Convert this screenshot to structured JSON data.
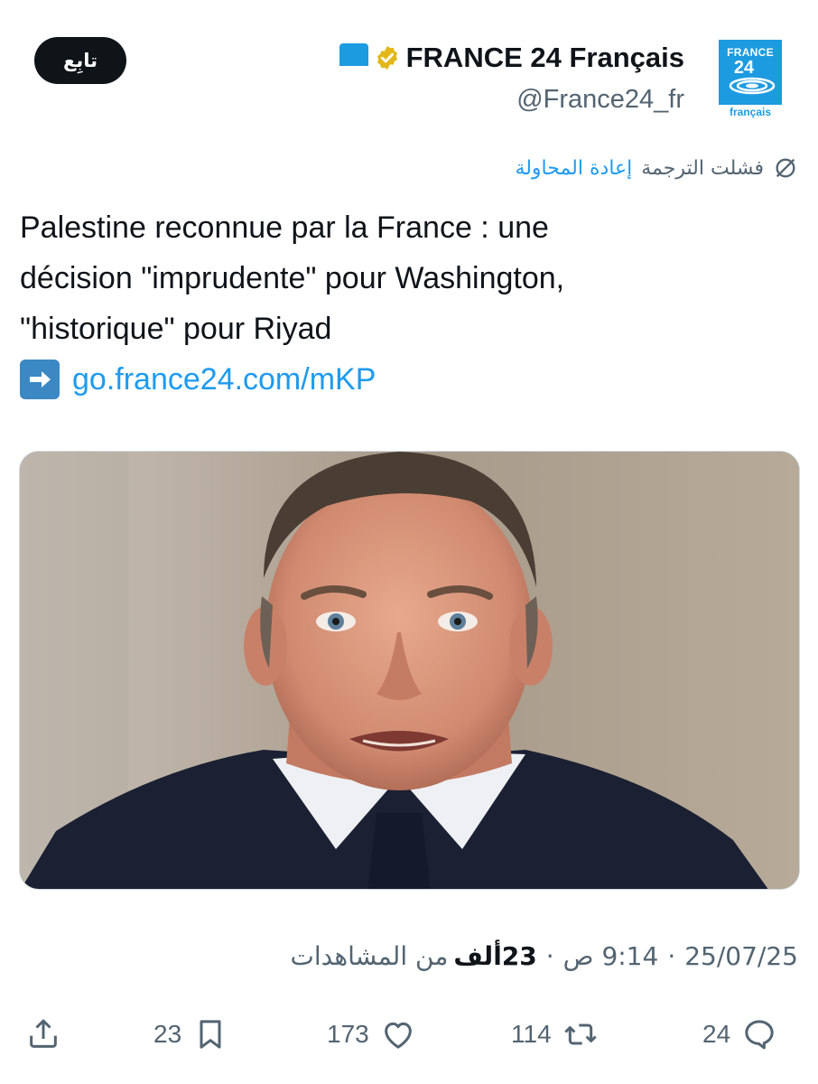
{
  "account": {
    "display_name": "FRANCE 24 Français",
    "handle": "@France24_fr",
    "avatar_brand_top": "FRANCE",
    "avatar_brand_num": "24",
    "avatar_brand_sub": "français",
    "verified": true,
    "brand_color": "#1d9be0"
  },
  "follow_button": {
    "label": "تابِع"
  },
  "translation": {
    "failed_text": "فشلت الترجمة",
    "retry_label": "إعادة المحاولة",
    "icon": "translate-failed-icon"
  },
  "tweet": {
    "lines": [
      "Palestine reconnue par la France : une",
      "décision \"imprudente\" pour Washington,",
      "\"historique\" pour Riyad"
    ],
    "link_emoji": "right-arrow-emoji",
    "link_text": "go.france24.com/mKP"
  },
  "media": {
    "description_icon": "photo-portrait"
  },
  "meta": {
    "date": "25/07/25",
    "time": "9:14 ص",
    "views_count": "23ألف",
    "views_label": "من المشاهدات",
    "separator": "·"
  },
  "actions": {
    "replies": "24",
    "retweets": "114",
    "likes": "173",
    "bookmarks": "23"
  },
  "colors": {
    "accent": "#1d9bf0",
    "text_primary": "#0f1419",
    "text_secondary": "#536471"
  }
}
